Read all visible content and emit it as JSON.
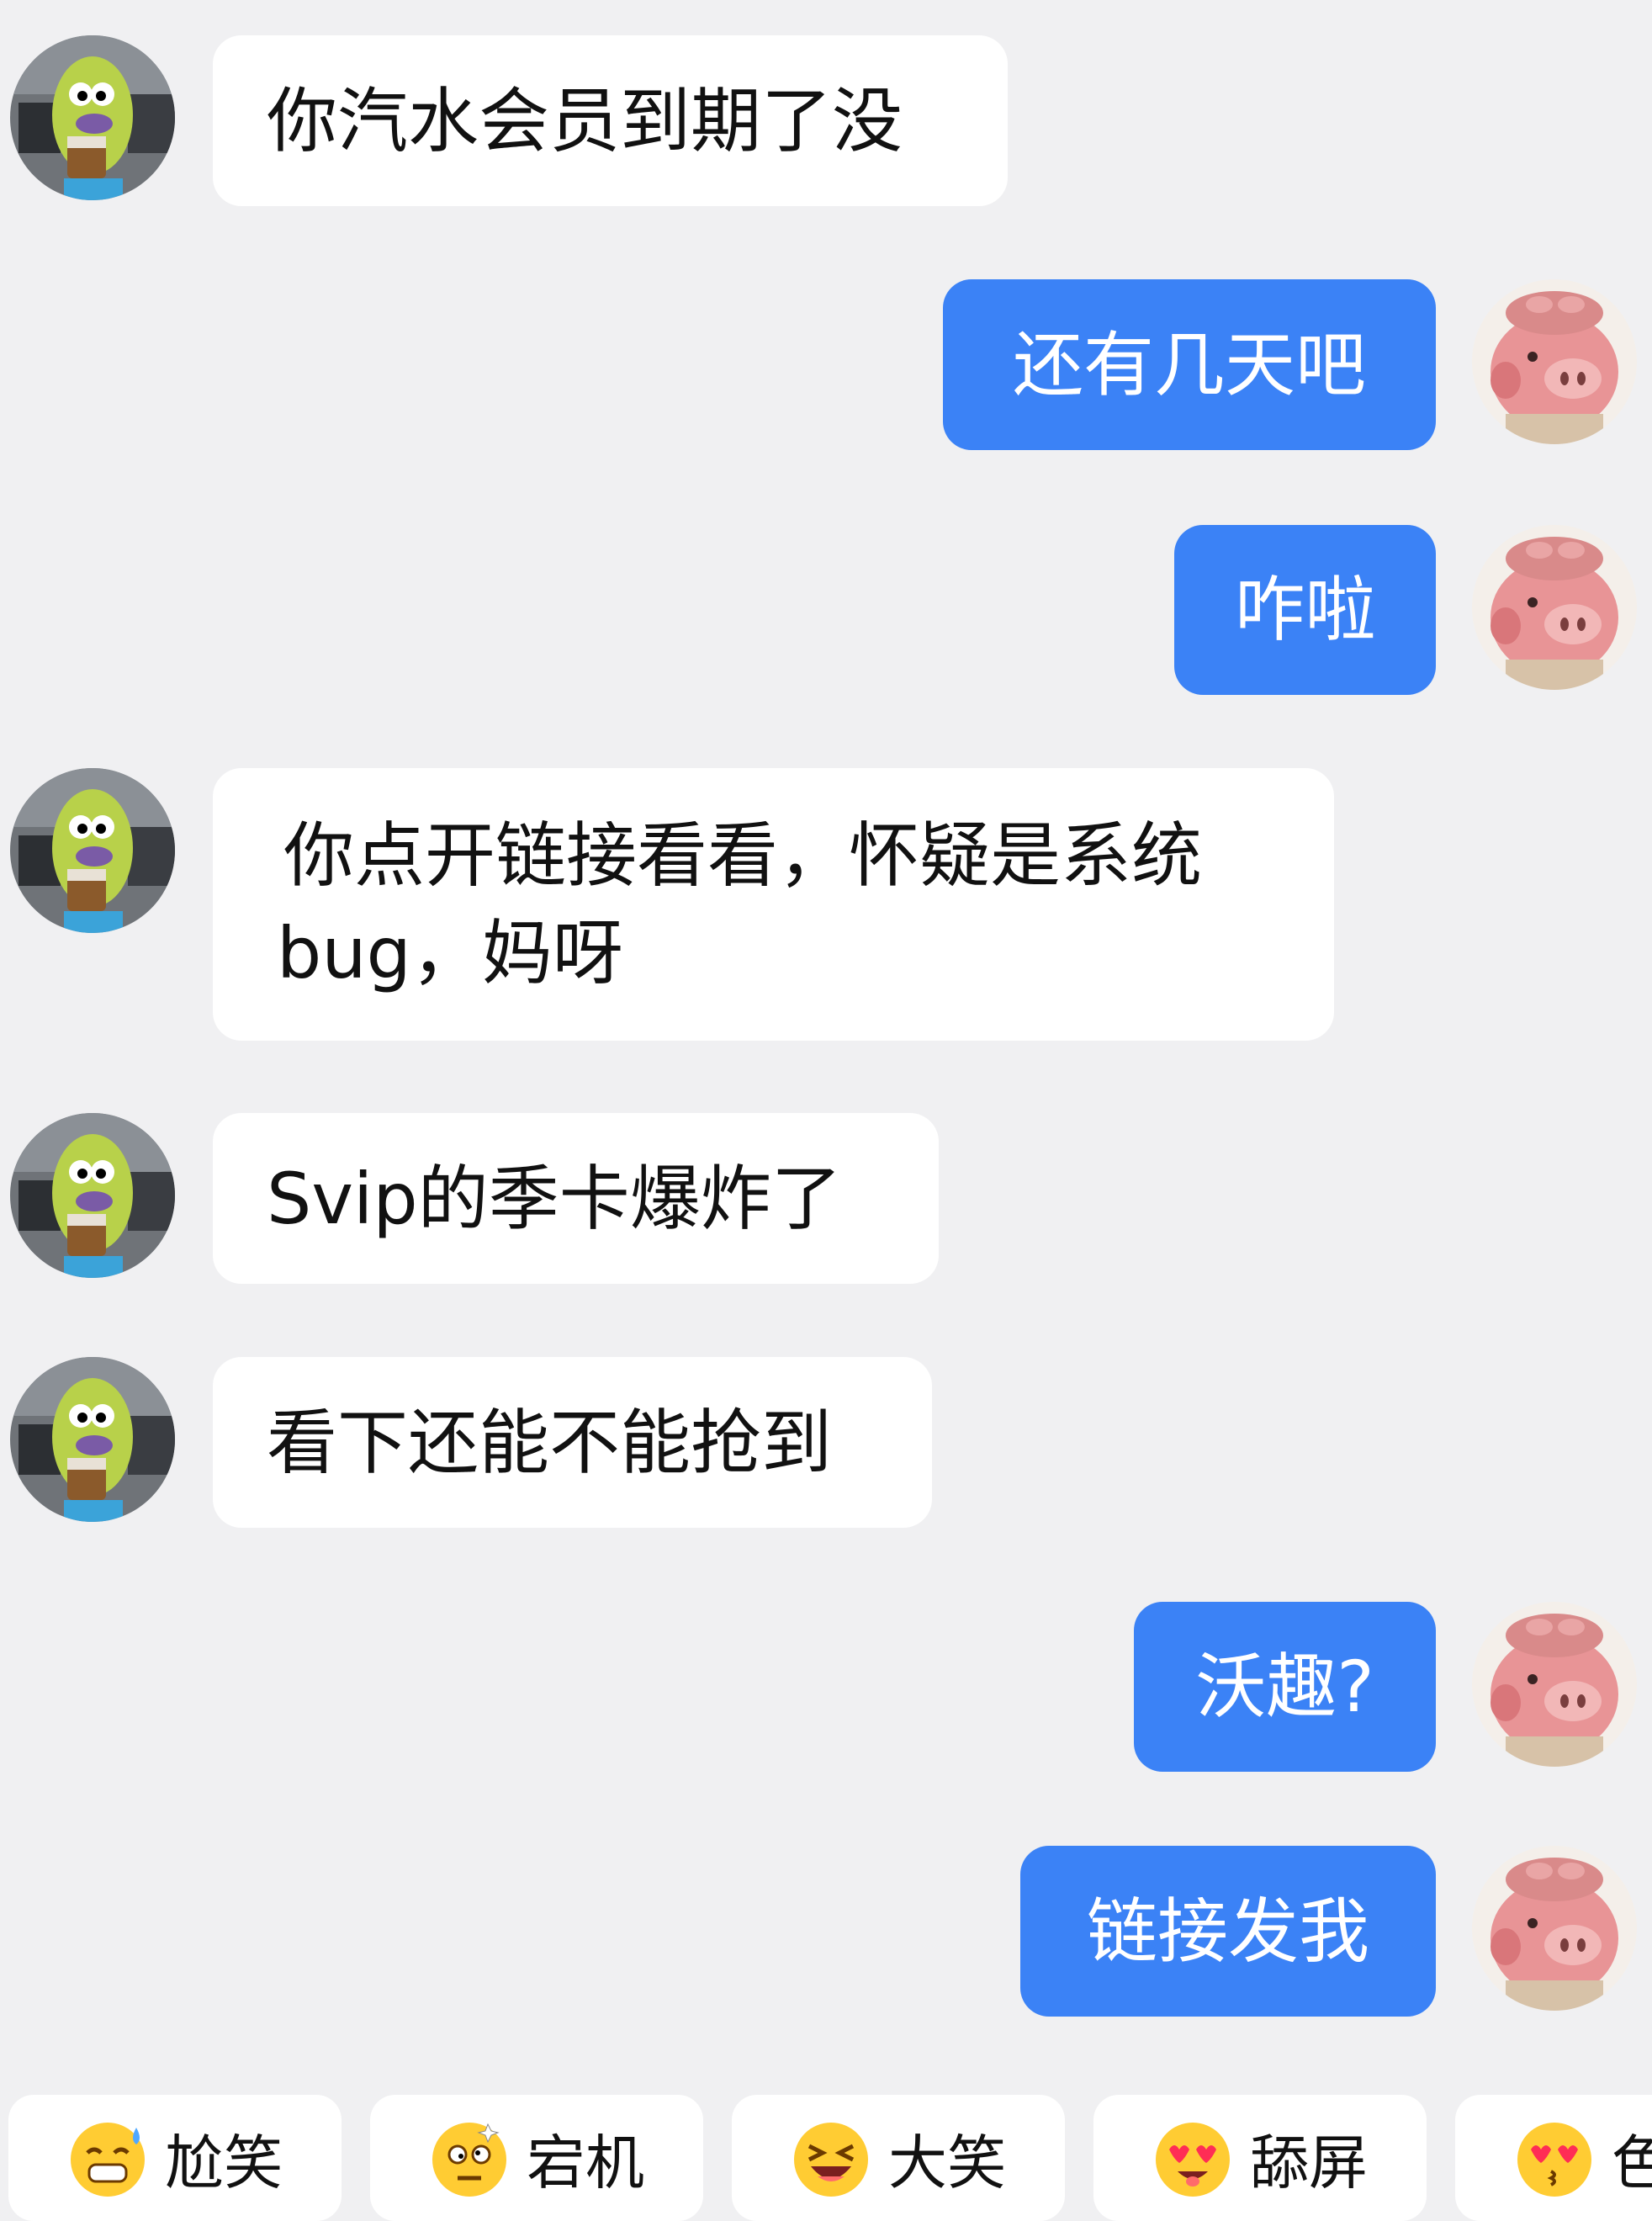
{
  "colors": {
    "background": "#F0F0F2",
    "incoming_bubble": "#FFFFFF",
    "outgoing_bubble": "#3B82F6",
    "outgoing_text": "#FFFFFF",
    "incoming_text": "#111111"
  },
  "messages": [
    {
      "sender": "other",
      "avatar": "cactus-avatar",
      "text": "你汽水会员到期了没"
    },
    {
      "sender": "me",
      "avatar": "pig-avatar",
      "text": "还有几天吧"
    },
    {
      "sender": "me",
      "avatar": "pig-avatar",
      "text": "咋啦"
    },
    {
      "sender": "other",
      "avatar": "cactus-avatar",
      "line1": "你点开链接看看，怀疑是系统",
      "line2": "bug，妈呀"
    },
    {
      "sender": "other",
      "avatar": "cactus-avatar",
      "text": "Svip的季卡爆炸了"
    },
    {
      "sender": "other",
      "avatar": "cactus-avatar",
      "text": "看下还能不能抢到"
    },
    {
      "sender": "me",
      "avatar": "pig-avatar",
      "text": "沃趣?"
    },
    {
      "sender": "me",
      "avatar": "pig-avatar",
      "text": "链接发我"
    }
  ],
  "quick_replies": [
    {
      "icon": "sweat-smile-emoji-icon",
      "label": "尬笑"
    },
    {
      "icon": "dazed-emoji-icon",
      "label": "宕机"
    },
    {
      "icon": "laughing-emoji-icon",
      "label": "大笑"
    },
    {
      "icon": "heart-eyes-emoji-icon",
      "label": "舔屏"
    },
    {
      "icon": "kiss-heart-emoji-icon",
      "label": "色"
    }
  ]
}
